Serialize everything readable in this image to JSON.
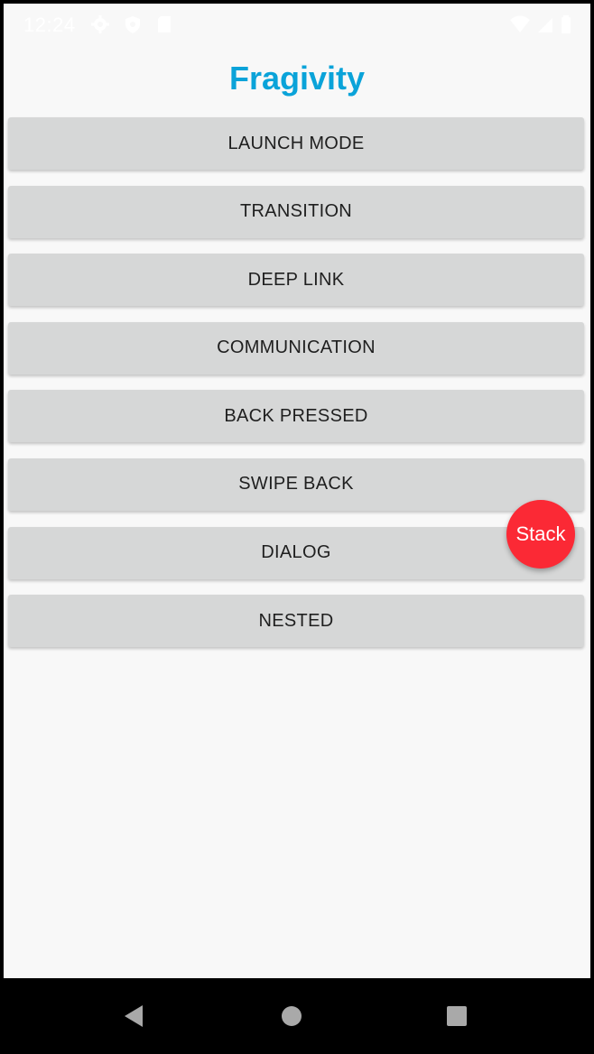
{
  "status_bar": {
    "time": "12:24",
    "left_icons": [
      "gear-icon",
      "shield-icon",
      "sd-card-icon"
    ],
    "right_icons": [
      "wifi-icon",
      "signal-icon",
      "battery-icon"
    ]
  },
  "app": {
    "title": "Fragivity",
    "title_color": "#0aa3d9"
  },
  "menu": {
    "items": [
      {
        "label": "LAUNCH MODE"
      },
      {
        "label": "TRANSITION"
      },
      {
        "label": "DEEP LINK"
      },
      {
        "label": "COMMUNICATION"
      },
      {
        "label": "BACK PRESSED"
      },
      {
        "label": "SWIPE BACK"
      },
      {
        "label": "DIALOG"
      },
      {
        "label": "NESTED"
      }
    ]
  },
  "fab": {
    "label": "Stack",
    "color": "#fb2935"
  },
  "nav_bar": {
    "buttons": [
      "back-triangle-icon",
      "home-circle-icon",
      "recents-square-icon"
    ]
  }
}
